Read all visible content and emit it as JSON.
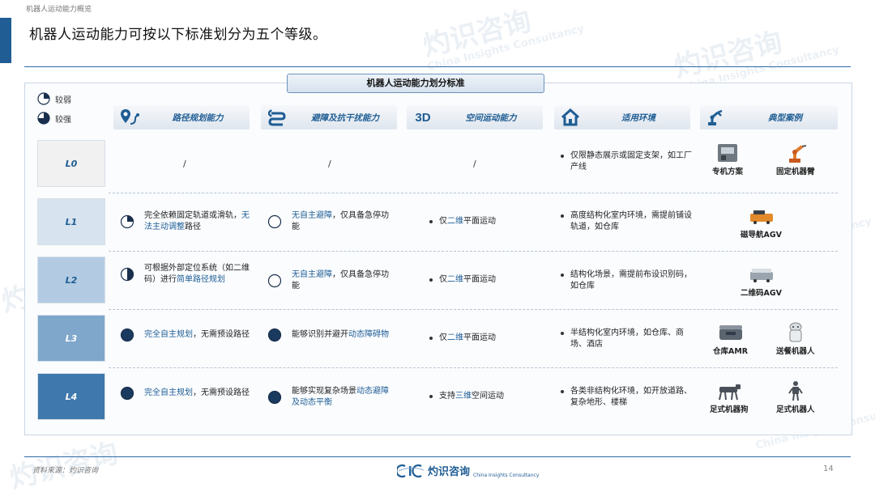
{
  "breadcrumb": "机器人运动能力概览",
  "title": "机器人运动能力可按以下标准划分为五个等级。",
  "banner": "机器人运动能力划分标准",
  "legend": {
    "weak": "较弱",
    "strong": "较强"
  },
  "columns": [
    {
      "icon": "map-pin-route-icon",
      "label": "路径规划能力"
    },
    {
      "icon": "avoid-arrows-icon",
      "label": "避障及抗干扰能力"
    },
    {
      "icon_text": "3D",
      "icon": "3d-icon",
      "label": "空间运动能力"
    },
    {
      "icon": "house-icon",
      "label": "适用环境"
    },
    {
      "icon": "robot-arm-icon",
      "label": "典型案例"
    }
  ],
  "levels": [
    {
      "id": "L0",
      "fill": "#f1f1f1",
      "text_color": "#1f5d94",
      "path": {
        "text": "/"
      },
      "avoid": {
        "text": "/"
      },
      "space": {
        "text": "/"
      },
      "env": "仅限静态展示或固定支架，如工厂产线",
      "cases": [
        {
          "label": "专机方案",
          "icon": "machine-icon"
        },
        {
          "label": "固定机器臂",
          "icon": "robot-arm-icon"
        }
      ]
    },
    {
      "id": "L1",
      "fill": "#d7e3ef",
      "text_color": "#1f5d94",
      "path": {
        "level": 0.25,
        "pre": "完全依赖固定轨道或滑轨，",
        "hl": "无法主动调整",
        "post": "路径"
      },
      "avoid": {
        "level": 0,
        "pre": "",
        "hl": "无自主避障",
        "post": "，仅具备急停功能"
      },
      "space": {
        "pre": "仅",
        "hl": "二维",
        "post": "平面运动"
      },
      "env": "高度结构化室内环境，需提前铺设轨道，如仓库",
      "cases": [
        {
          "label": "磁导航AGV",
          "icon": "agv-icon"
        }
      ]
    },
    {
      "id": "L2",
      "fill": "#b2cbe2",
      "text_color": "#1f5d94",
      "path": {
        "level": 0.5,
        "pre": "可根据外部定位系统（如二维码）进行",
        "hl": "简单路径规划",
        "post": ""
      },
      "avoid": {
        "level": 0,
        "pre": "",
        "hl": "无自主避障",
        "post": "，仅具备急停功能"
      },
      "space": {
        "pre": "仅",
        "hl": "二维",
        "post": "平面运动"
      },
      "env": "结构化场景，需提前布设识别码，如仓库",
      "cases": [
        {
          "label": "二维码AGV",
          "icon": "agv-icon"
        }
      ]
    },
    {
      "id": "L3",
      "fill": "#7ea7cb",
      "text_color": "#ffffff",
      "path": {
        "level": 1,
        "pre": "",
        "hl": "完全自主规划",
        "post": "，无需预设路径"
      },
      "avoid": {
        "level": 1,
        "pre": "能够识别并避开",
        "hl": "动态障碍物",
        "post": ""
      },
      "space": {
        "pre": "仅",
        "hl": "二维",
        "post": "平面运动"
      },
      "env": "半结构化室内环境，如仓库、商场、酒店",
      "cases": [
        {
          "label": "仓库AMR",
          "icon": "amr-icon"
        },
        {
          "label": "送餐机器人",
          "icon": "delivery-robot-icon"
        }
      ]
    },
    {
      "id": "L4",
      "fill": "#3f78ad",
      "text_color": "#ffffff",
      "path": {
        "level": 1,
        "pre": "",
        "hl": "完全自主规划",
        "post": "，无需预设路径"
      },
      "avoid": {
        "level": 1,
        "pre": "能够实现复杂场景",
        "hl": "动态避障及动态平衡",
        "post": ""
      },
      "space": {
        "pre": "支持",
        "hl": "三维",
        "post": "空间运动"
      },
      "env": "各类非结构化环境，如开放道路、复杂地形、楼梯",
      "cases": [
        {
          "label": "足式机器狗",
          "icon": "robot-dog-icon"
        },
        {
          "label": "足式机器人",
          "icon": "legged-robot-icon"
        }
      ]
    }
  ],
  "footer": {
    "source": "资料来源：灼识咨询",
    "logo_cn": "灼识咨询",
    "logo_en": "China Insights Consultancy",
    "page": "14"
  },
  "watermark": {
    "cn": "灼识咨询",
    "en": "China Insights Consultancy"
  },
  "colors": {
    "accent": "#1f5d94",
    "rule": "#2e6aa8"
  }
}
